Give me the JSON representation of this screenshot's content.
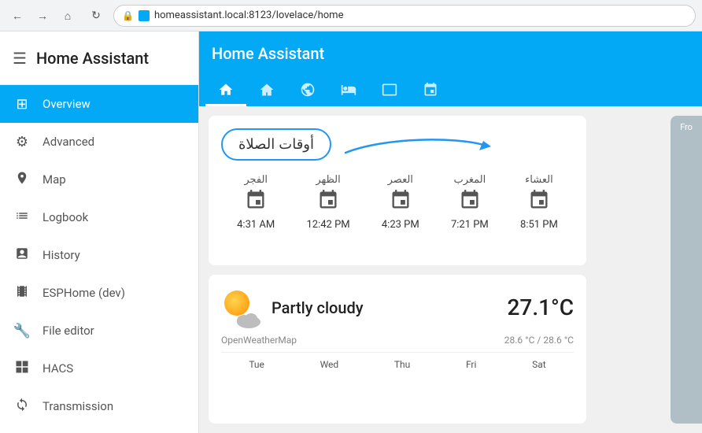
{
  "browser": {
    "back_icon": "←",
    "forward_icon": "→",
    "home_icon": "⌂",
    "refresh_icon": "↻",
    "url": "homeassistant.local:8123/lovelace/home"
  },
  "sidebar": {
    "title": "Home Assistant",
    "menu_icon": "☰",
    "items": [
      {
        "id": "overview",
        "label": "Overview",
        "icon": "⊞",
        "active": true
      },
      {
        "id": "advanced",
        "label": "Advanced",
        "icon": "⚙",
        "active": false
      },
      {
        "id": "map",
        "label": "Map",
        "icon": "👤",
        "active": false
      },
      {
        "id": "logbook",
        "label": "Logbook",
        "icon": "☰",
        "active": false
      },
      {
        "id": "history",
        "label": "History",
        "icon": "▦",
        "active": false
      },
      {
        "id": "esphome",
        "label": "ESPHome (dev)",
        "icon": "▤",
        "active": false
      },
      {
        "id": "file-editor",
        "label": "File editor",
        "icon": "🔧",
        "active": false
      },
      {
        "id": "hacs",
        "label": "HACS",
        "icon": "◼",
        "active": false
      },
      {
        "id": "transmission",
        "label": "Transmission",
        "icon": "↺",
        "active": false
      }
    ]
  },
  "topbar": {
    "title": "Home Assistant"
  },
  "tabs": [
    {
      "id": "home",
      "icon": "⌂",
      "active": true
    },
    {
      "id": "tab2",
      "icon": "▲",
      "active": false
    },
    {
      "id": "tab3",
      "icon": "⬡",
      "active": false
    },
    {
      "id": "tab4",
      "icon": "🛁",
      "active": false
    },
    {
      "id": "tab5",
      "icon": "▭",
      "active": false
    },
    {
      "id": "tab6",
      "icon": "⊟",
      "active": false
    }
  ],
  "prayer_card": {
    "title": "أوقات الصلاة",
    "prayers": [
      {
        "name": "الفجر",
        "time": "4:31 AM"
      },
      {
        "name": "الظهر",
        "time": "12:42 PM"
      },
      {
        "name": "العصر",
        "time": "4:23 PM"
      },
      {
        "name": "المغرب",
        "time": "7:21 PM"
      },
      {
        "name": "العشاء",
        "time": "8:51 PM"
      }
    ]
  },
  "weather_card": {
    "description": "Partly cloudy",
    "temperature": "27.1°C",
    "source": "OpenWeatherMap",
    "min_max": "28.6 °C / 28.6 °C",
    "days": [
      "Tue",
      "Wed",
      "Thu",
      "Fri",
      "Sat"
    ]
  },
  "right_panel": {
    "label": "Fro"
  }
}
